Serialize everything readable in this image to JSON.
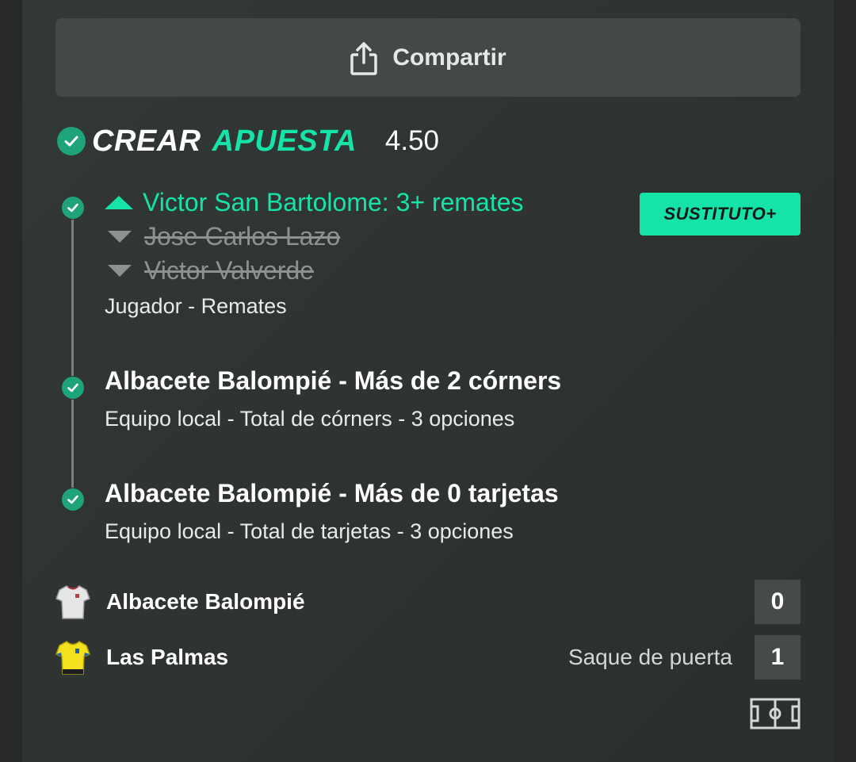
{
  "share": {
    "label": "Compartir",
    "icon": "share-icon"
  },
  "header": {
    "crear": "CREAR",
    "apuesta": "APUESTA",
    "odds": "4.50"
  },
  "badge": "SUSTITUTO+",
  "selections": [
    {
      "main": "Victor San Bartolome: 3+ remates",
      "struck": [
        "Jose Carlos Lazo",
        "Victor Valverde"
      ],
      "sub": "Jugador - Remates"
    },
    {
      "title": "Albacete Balompié - Más de 2 córners",
      "sub": "Equipo local - Total de córners - 3 opciones"
    },
    {
      "title": "Albacete Balompié - Más de 0 tarjetas",
      "sub": "Equipo local - Total de tarjetas - 3 opciones"
    }
  ],
  "teams": [
    {
      "name": "Albacete Balompié",
      "score": "0",
      "event": "",
      "shirt_color": "#e6e6e6"
    },
    {
      "name": "Las Palmas",
      "score": "1",
      "event": "Saque de puerta",
      "shirt_color": "#f2e11c"
    }
  ],
  "colors": {
    "accent": "#16e3a8",
    "check": "#1fa37a",
    "background": "#2e3331"
  }
}
